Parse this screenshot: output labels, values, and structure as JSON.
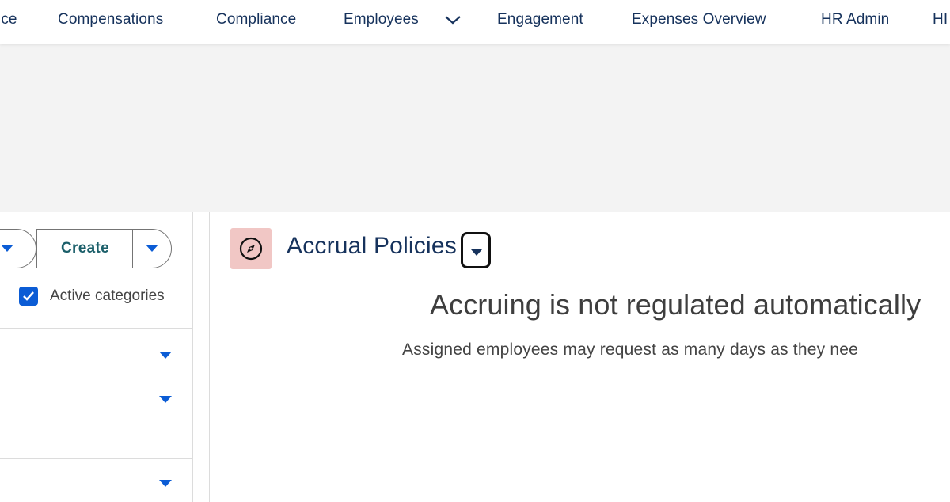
{
  "nav": {
    "items": [
      {
        "label": "ice"
      },
      {
        "label": "Compensations"
      },
      {
        "label": "Compliance"
      },
      {
        "label": "Employees"
      },
      {
        "label": "Engagement"
      },
      {
        "label": "Expenses Overview"
      },
      {
        "label": "HR Admin"
      },
      {
        "label": "HI"
      }
    ],
    "employees_chevron_icon": "chevron-down-icon"
  },
  "left_panel": {
    "create_button_label": "Create",
    "checkbox_label": "Active categories",
    "checkbox_checked": true
  },
  "main": {
    "title": "Accrual Policies",
    "title_icon": "compass-icon",
    "headline": "Accruing is not regulated automatically",
    "subline": "Assigned employees may request as many days as they nee"
  },
  "colors": {
    "nav_text": "#16325c",
    "accent_blue": "#0b5cd5",
    "create_text": "#1b5f6a",
    "icon_bg": "#f1c7c5",
    "banner_bg": "#f3f3f3"
  }
}
